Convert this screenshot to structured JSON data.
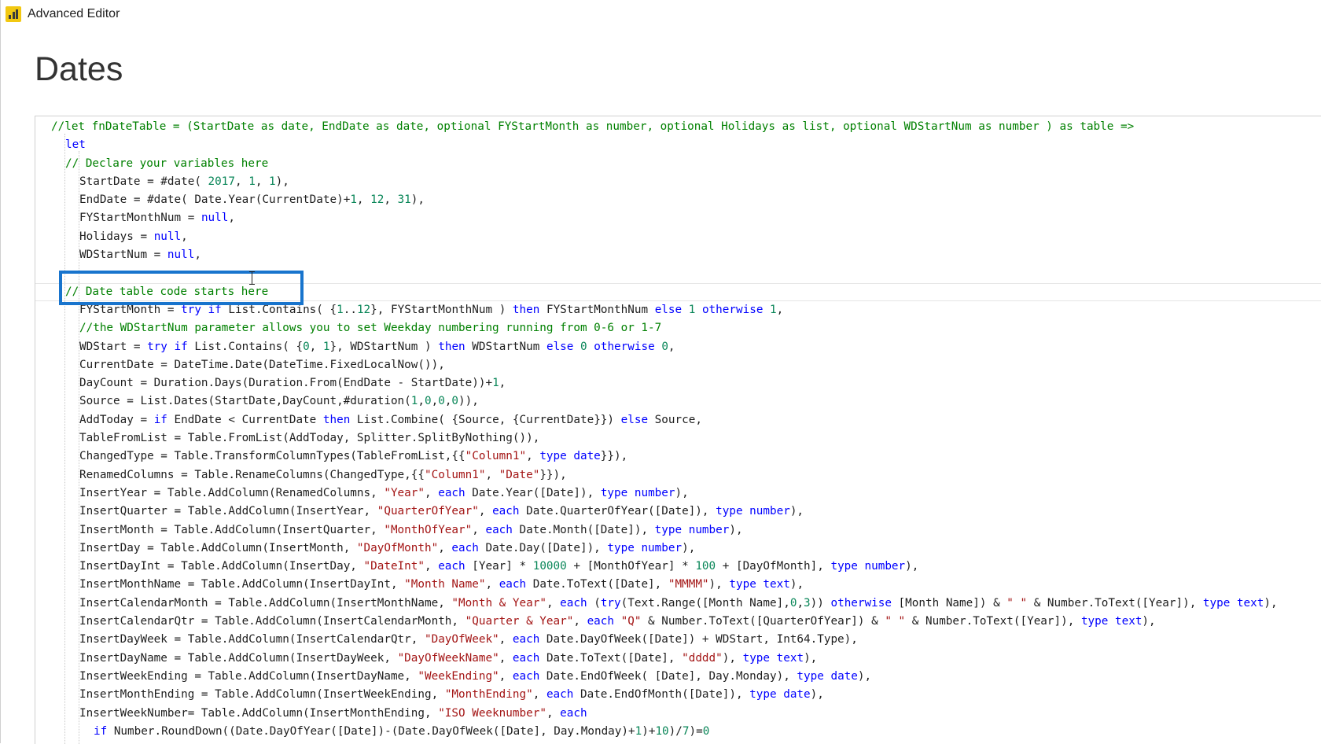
{
  "window": {
    "title": "Advanced Editor",
    "icon": "power-bi-icon"
  },
  "query": {
    "name": "Dates"
  },
  "editor": {
    "highlight_color": "#1874cd",
    "current_line_index": 9,
    "token_colors": {
      "kw": "#0000ff",
      "str": "#a31515",
      "num": "#098658",
      "cm": "#008000",
      "pl": "#1e1e1e"
    },
    "lines": [
      {
        "i": 1,
        "t": [
          [
            "cm",
            "//let fnDateTable = (StartDate as date, EndDate as date, optional FYStartMonth as number, optional Holidays as list, optional WDStartNum as number ) as table =>"
          ]
        ]
      },
      {
        "i": 2,
        "t": [
          [
            "kw",
            "let"
          ]
        ]
      },
      {
        "i": 2,
        "t": [
          [
            "cm",
            "// Declare your variables here"
          ]
        ]
      },
      {
        "i": 3,
        "t": [
          [
            "pl",
            "StartDate = #date( "
          ],
          [
            "num",
            "2017"
          ],
          [
            "pl",
            ", "
          ],
          [
            "num",
            "1"
          ],
          [
            "pl",
            ", "
          ],
          [
            "num",
            "1"
          ],
          [
            "pl",
            "),"
          ]
        ]
      },
      {
        "i": 3,
        "t": [
          [
            "pl",
            "EndDate = #date( Date.Year(CurrentDate)+"
          ],
          [
            "num",
            "1"
          ],
          [
            "pl",
            ", "
          ],
          [
            "num",
            "12"
          ],
          [
            "pl",
            ", "
          ],
          [
            "num",
            "31"
          ],
          [
            "pl",
            "),"
          ]
        ]
      },
      {
        "i": 3,
        "t": [
          [
            "pl",
            "FYStartMonthNum = "
          ],
          [
            "kw",
            "null"
          ],
          [
            "pl",
            ","
          ]
        ]
      },
      {
        "i": 3,
        "t": [
          [
            "pl",
            "Holidays = "
          ],
          [
            "kw",
            "null"
          ],
          [
            "pl",
            ","
          ]
        ]
      },
      {
        "i": 3,
        "t": [
          [
            "pl",
            "WDStartNum = "
          ],
          [
            "kw",
            "null"
          ],
          [
            "pl",
            ","
          ]
        ]
      },
      {
        "i": 0,
        "t": []
      },
      {
        "i": 2,
        "t": [
          [
            "cm",
            "// Date table code starts here"
          ]
        ]
      },
      {
        "i": 3,
        "t": [
          [
            "pl",
            "FYStartMonth = "
          ],
          [
            "kw",
            "try if"
          ],
          [
            "pl",
            " List.Contains( {"
          ],
          [
            "num",
            "1"
          ],
          [
            "pl",
            ".."
          ],
          [
            "num",
            "12"
          ],
          [
            "pl",
            "}, FYStartMonthNum ) "
          ],
          [
            "kw",
            "then"
          ],
          [
            "pl",
            " FYStartMonthNum "
          ],
          [
            "kw",
            "else"
          ],
          [
            "pl",
            " "
          ],
          [
            "num",
            "1"
          ],
          [
            "pl",
            " "
          ],
          [
            "kw",
            "otherwise"
          ],
          [
            "pl",
            " "
          ],
          [
            "num",
            "1"
          ],
          [
            "pl",
            ","
          ]
        ]
      },
      {
        "i": 3,
        "t": [
          [
            "cm",
            "//the WDStartNum parameter allows you to set Weekday numbering running from 0-6 or 1-7"
          ]
        ]
      },
      {
        "i": 3,
        "t": [
          [
            "pl",
            "WDStart = "
          ],
          [
            "kw",
            "try if"
          ],
          [
            "pl",
            " List.Contains( {"
          ],
          [
            "num",
            "0"
          ],
          [
            "pl",
            ", "
          ],
          [
            "num",
            "1"
          ],
          [
            "pl",
            "}, WDStartNum ) "
          ],
          [
            "kw",
            "then"
          ],
          [
            "pl",
            " WDStartNum "
          ],
          [
            "kw",
            "else"
          ],
          [
            "pl",
            " "
          ],
          [
            "num",
            "0"
          ],
          [
            "pl",
            " "
          ],
          [
            "kw",
            "otherwise"
          ],
          [
            "pl",
            " "
          ],
          [
            "num",
            "0"
          ],
          [
            "pl",
            ","
          ]
        ]
      },
      {
        "i": 3,
        "t": [
          [
            "pl",
            "CurrentDate = DateTime.Date(DateTime.FixedLocalNow()),"
          ]
        ]
      },
      {
        "i": 3,
        "t": [
          [
            "pl",
            "DayCount = Duration.Days(Duration.From(EndDate - StartDate))+"
          ],
          [
            "num",
            "1"
          ],
          [
            "pl",
            ","
          ]
        ]
      },
      {
        "i": 3,
        "t": [
          [
            "pl",
            "Source = List.Dates(StartDate,DayCount,#duration("
          ],
          [
            "num",
            "1"
          ],
          [
            "pl",
            ","
          ],
          [
            "num",
            "0"
          ],
          [
            "pl",
            ","
          ],
          [
            "num",
            "0"
          ],
          [
            "pl",
            ","
          ],
          [
            "num",
            "0"
          ],
          [
            "pl",
            ")),"
          ]
        ]
      },
      {
        "i": 3,
        "t": [
          [
            "pl",
            "AddToday = "
          ],
          [
            "kw",
            "if"
          ],
          [
            "pl",
            " EndDate < CurrentDate "
          ],
          [
            "kw",
            "then"
          ],
          [
            "pl",
            " List.Combine( {Source, {CurrentDate}}) "
          ],
          [
            "kw",
            "else"
          ],
          [
            "pl",
            " Source,"
          ]
        ]
      },
      {
        "i": 3,
        "t": [
          [
            "pl",
            "TableFromList = Table.FromList(AddToday, Splitter.SplitByNothing()),"
          ]
        ]
      },
      {
        "i": 3,
        "t": [
          [
            "pl",
            "ChangedType = Table.TransformColumnTypes(TableFromList,{{"
          ],
          [
            "str",
            "\"Column1\""
          ],
          [
            "pl",
            ", "
          ],
          [
            "kw",
            "type date"
          ],
          [
            "pl",
            "}}),"
          ]
        ]
      },
      {
        "i": 3,
        "t": [
          [
            "pl",
            "RenamedColumns = Table.RenameColumns(ChangedType,{{"
          ],
          [
            "str",
            "\"Column1\""
          ],
          [
            "pl",
            ", "
          ],
          [
            "str",
            "\"Date\""
          ],
          [
            "pl",
            "}}),"
          ]
        ]
      },
      {
        "i": 3,
        "t": [
          [
            "pl",
            "InsertYear = Table.AddColumn(RenamedColumns, "
          ],
          [
            "str",
            "\"Year\""
          ],
          [
            "pl",
            ", "
          ],
          [
            "kw",
            "each"
          ],
          [
            "pl",
            " Date.Year([Date]), "
          ],
          [
            "kw",
            "type number"
          ],
          [
            "pl",
            "),"
          ]
        ]
      },
      {
        "i": 3,
        "t": [
          [
            "pl",
            "InsertQuarter = Table.AddColumn(InsertYear, "
          ],
          [
            "str",
            "\"QuarterOfYear\""
          ],
          [
            "pl",
            ", "
          ],
          [
            "kw",
            "each"
          ],
          [
            "pl",
            " Date.QuarterOfYear([Date]), "
          ],
          [
            "kw",
            "type number"
          ],
          [
            "pl",
            "),"
          ]
        ]
      },
      {
        "i": 3,
        "t": [
          [
            "pl",
            "InsertMonth = Table.AddColumn(InsertQuarter, "
          ],
          [
            "str",
            "\"MonthOfYear\""
          ],
          [
            "pl",
            ", "
          ],
          [
            "kw",
            "each"
          ],
          [
            "pl",
            " Date.Month([Date]), "
          ],
          [
            "kw",
            "type number"
          ],
          [
            "pl",
            "),"
          ]
        ]
      },
      {
        "i": 3,
        "t": [
          [
            "pl",
            "InsertDay = Table.AddColumn(InsertMonth, "
          ],
          [
            "str",
            "\"DayOfMonth\""
          ],
          [
            "pl",
            ", "
          ],
          [
            "kw",
            "each"
          ],
          [
            "pl",
            " Date.Day([Date]), "
          ],
          [
            "kw",
            "type number"
          ],
          [
            "pl",
            "),"
          ]
        ]
      },
      {
        "i": 3,
        "t": [
          [
            "pl",
            "InsertDayInt = Table.AddColumn(InsertDay, "
          ],
          [
            "str",
            "\"DateInt\""
          ],
          [
            "pl",
            ", "
          ],
          [
            "kw",
            "each"
          ],
          [
            "pl",
            " [Year] * "
          ],
          [
            "num",
            "10000"
          ],
          [
            "pl",
            " + [MonthOfYear] * "
          ],
          [
            "num",
            "100"
          ],
          [
            "pl",
            " + [DayOfMonth], "
          ],
          [
            "kw",
            "type number"
          ],
          [
            "pl",
            "),"
          ]
        ]
      },
      {
        "i": 3,
        "t": [
          [
            "pl",
            "InsertMonthName = Table.AddColumn(InsertDayInt, "
          ],
          [
            "str",
            "\"Month Name\""
          ],
          [
            "pl",
            ", "
          ],
          [
            "kw",
            "each"
          ],
          [
            "pl",
            " Date.ToText([Date], "
          ],
          [
            "str",
            "\"MMMM\""
          ],
          [
            "pl",
            "), "
          ],
          [
            "kw",
            "type text"
          ],
          [
            "pl",
            "),"
          ]
        ]
      },
      {
        "i": 3,
        "t": [
          [
            "pl",
            "InsertCalendarMonth = Table.AddColumn(InsertMonthName, "
          ],
          [
            "str",
            "\"Month & Year\""
          ],
          [
            "pl",
            ", "
          ],
          [
            "kw",
            "each"
          ],
          [
            "pl",
            " ("
          ],
          [
            "kw",
            "try"
          ],
          [
            "pl",
            "(Text.Range([Month Name],"
          ],
          [
            "num",
            "0"
          ],
          [
            "pl",
            ","
          ],
          [
            "num",
            "3"
          ],
          [
            "pl",
            ")) "
          ],
          [
            "kw",
            "otherwise"
          ],
          [
            "pl",
            " [Month Name]) & "
          ],
          [
            "str",
            "\" \""
          ],
          [
            "pl",
            " & Number.ToText([Year]), "
          ],
          [
            "kw",
            "type text"
          ],
          [
            "pl",
            "),"
          ]
        ]
      },
      {
        "i": 3,
        "t": [
          [
            "pl",
            "InsertCalendarQtr = Table.AddColumn(InsertCalendarMonth, "
          ],
          [
            "str",
            "\"Quarter & Year\""
          ],
          [
            "pl",
            ", "
          ],
          [
            "kw",
            "each"
          ],
          [
            "pl",
            " "
          ],
          [
            "str",
            "\"Q\""
          ],
          [
            "pl",
            " & Number.ToText([QuarterOfYear]) & "
          ],
          [
            "str",
            "\" \""
          ],
          [
            "pl",
            " & Number.ToText([Year]), "
          ],
          [
            "kw",
            "type text"
          ],
          [
            "pl",
            "),"
          ]
        ]
      },
      {
        "i": 3,
        "t": [
          [
            "pl",
            "InsertDayWeek = Table.AddColumn(InsertCalendarQtr, "
          ],
          [
            "str",
            "\"DayOfWeek\""
          ],
          [
            "pl",
            ", "
          ],
          [
            "kw",
            "each"
          ],
          [
            "pl",
            " Date.DayOfWeek([Date]) + WDStart, Int64.Type),"
          ]
        ]
      },
      {
        "i": 3,
        "t": [
          [
            "pl",
            "InsertDayName = Table.AddColumn(InsertDayWeek, "
          ],
          [
            "str",
            "\"DayOfWeekName\""
          ],
          [
            "pl",
            ", "
          ],
          [
            "kw",
            "each"
          ],
          [
            "pl",
            " Date.ToText([Date], "
          ],
          [
            "str",
            "\"dddd\""
          ],
          [
            "pl",
            "), "
          ],
          [
            "kw",
            "type text"
          ],
          [
            "pl",
            "),"
          ]
        ]
      },
      {
        "i": 3,
        "t": [
          [
            "pl",
            "InsertWeekEnding = Table.AddColumn(InsertDayName, "
          ],
          [
            "str",
            "\"WeekEnding\""
          ],
          [
            "pl",
            ", "
          ],
          [
            "kw",
            "each"
          ],
          [
            "pl",
            " Date.EndOfWeek( [Date], Day.Monday), "
          ],
          [
            "kw",
            "type date"
          ],
          [
            "pl",
            "),"
          ]
        ]
      },
      {
        "i": 3,
        "t": [
          [
            "pl",
            "InsertMonthEnding = Table.AddColumn(InsertWeekEnding, "
          ],
          [
            "str",
            "\"MonthEnding\""
          ],
          [
            "pl",
            ", "
          ],
          [
            "kw",
            "each"
          ],
          [
            "pl",
            " Date.EndOfMonth([Date]), "
          ],
          [
            "kw",
            "type date"
          ],
          [
            "pl",
            "),"
          ]
        ]
      },
      {
        "i": 3,
        "t": [
          [
            "pl",
            "InsertWeekNumber= Table.AddColumn(InsertMonthEnding, "
          ],
          [
            "str",
            "\"ISO Weeknumber\""
          ],
          [
            "pl",
            ", "
          ],
          [
            "kw",
            "each"
          ]
        ]
      },
      {
        "i": 4,
        "t": [
          [
            "kw",
            "if"
          ],
          [
            "pl",
            " Number.RoundDown((Date.DayOfYear([Date])-(Date.DayOfWeek([Date], Day.Monday)+"
          ],
          [
            "num",
            "1"
          ],
          [
            "pl",
            ")+"
          ],
          [
            "num",
            "10"
          ],
          [
            "pl",
            ")/"
          ],
          [
            "num",
            "7"
          ],
          [
            "pl",
            ")="
          ],
          [
            "num",
            "0"
          ]
        ]
      }
    ]
  }
}
